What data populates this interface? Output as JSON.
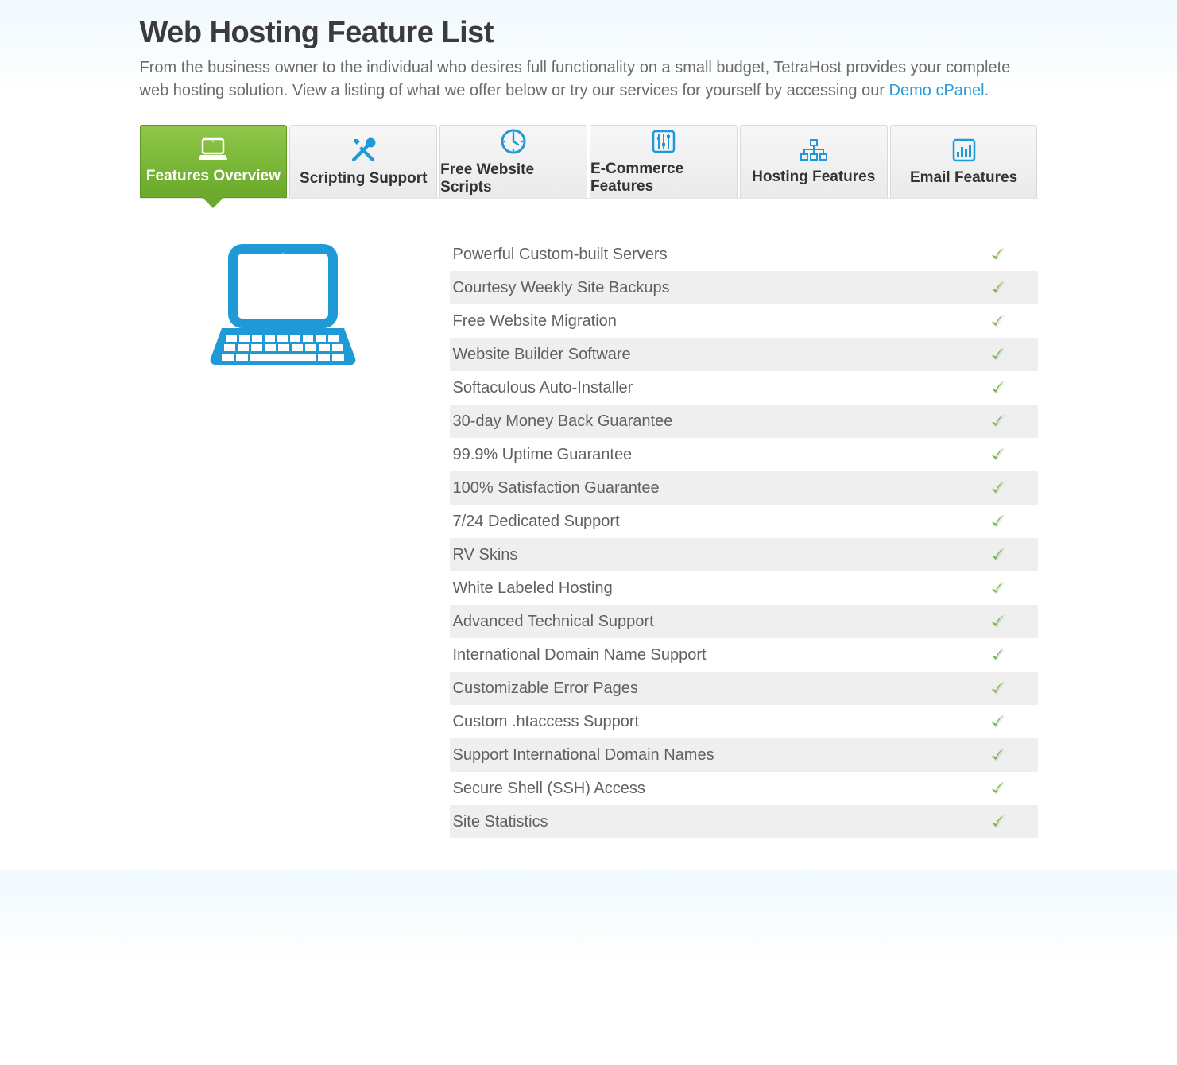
{
  "header": {
    "title": "Web Hosting Feature List",
    "intro_before": "From the business owner to the individual who desires full functionality on a small budget, TetraHost provides your complete web hosting solution. View a listing of what we offer below or try our services for yourself by accessing our ",
    "intro_link": "Demo cPanel",
    "intro_after": "."
  },
  "tabs": [
    {
      "label": "Features Overview",
      "icon": "laptop",
      "active": true
    },
    {
      "label": "Scripting Support",
      "icon": "tools",
      "active": false
    },
    {
      "label": "Free Website Scripts",
      "icon": "clock",
      "active": false
    },
    {
      "label": "E-Commerce Features",
      "icon": "sliders",
      "active": false
    },
    {
      "label": "Hosting Features",
      "icon": "sitemap",
      "active": false
    },
    {
      "label": "Email Features",
      "icon": "bars",
      "active": false
    }
  ],
  "features": [
    "Powerful Custom-built Servers",
    "Courtesy Weekly Site Backups",
    "Free Website Migration",
    "Website Builder Software",
    "Softaculous Auto-Installer",
    "30-day Money Back Guarantee",
    "99.9% Uptime Guarantee",
    "100% Satisfaction Guarantee",
    "7/24 Dedicated Support",
    "RV Skins",
    "White Labeled Hosting",
    "Advanced Technical Support",
    "International Domain Name Support",
    "Customizable Error Pages",
    "Custom .htaccess Support",
    "Support International Domain Names",
    "Secure Shell (SSH) Access",
    "Site Statistics"
  ],
  "colors": {
    "accent_blue": "#1f9ad6",
    "accent_green": "#74b52e",
    "check_green": "#6fb93a"
  }
}
